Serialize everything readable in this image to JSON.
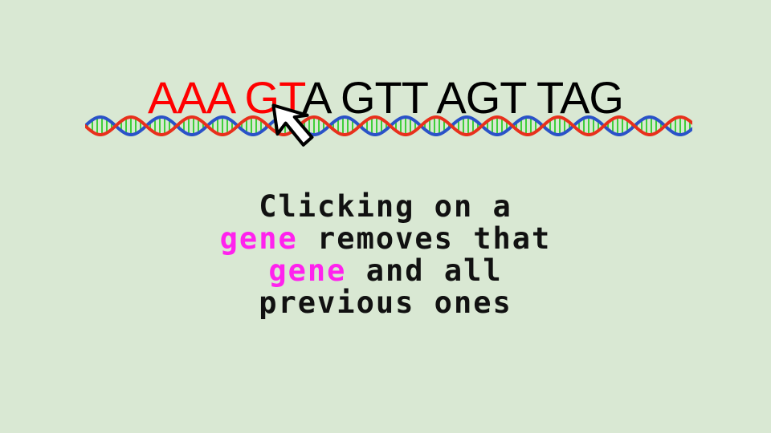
{
  "sequence": {
    "removed": "AAA GT",
    "remaining": "A GTT AGT TAG"
  },
  "instructions": {
    "line1": "Clicking on a",
    "line2_keyword": "gene",
    "line2_rest": " removes that",
    "line3_keyword": "gene",
    "line3_rest": " and all",
    "line4": "previous ones"
  },
  "icons": {
    "cursor": "mouse-pointer-icon",
    "dna": "dna-helix-icon"
  },
  "colors": {
    "background": "#d9e8d3",
    "removed": "#ff0000",
    "remaining": "#000000",
    "keyword": "#ff22ee",
    "dna_strand_a": "#e8301c",
    "dna_strand_b": "#2a52c8",
    "dna_rungs": "#3fcf3a"
  }
}
